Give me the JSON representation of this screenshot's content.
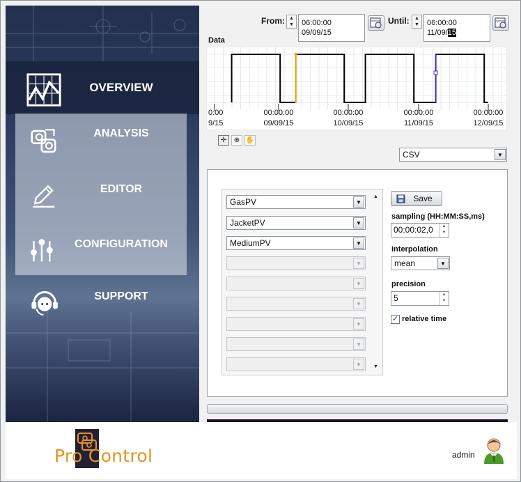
{
  "sidebar": {
    "items": [
      {
        "label": "OVERVIEW",
        "icon": "chart-icon",
        "active": true
      },
      {
        "label": "ANALYSIS",
        "icon": "analysis-icon"
      },
      {
        "label": "EDITOR",
        "icon": "pencil-icon"
      },
      {
        "label": "CONFIGURATION",
        "icon": "sliders-icon"
      },
      {
        "label": "SUPPORT",
        "icon": "headset-icon"
      }
    ]
  },
  "time_range": {
    "from_label": "From:",
    "from_time": "06:00:00",
    "from_date": "09/09/15",
    "until_label": "Until:",
    "until_time": "06:00:00",
    "until_date_prefix": "11/09/",
    "until_date_selected": "15"
  },
  "data_chart": {
    "title": "Data",
    "x_ticks": [
      {
        "time": "0:00",
        "date": "9/15"
      },
      {
        "time": "00:00:00",
        "date": "09/09/15"
      },
      {
        "time": "00:00:00",
        "date": "10/09/15"
      },
      {
        "time": "00:00:00",
        "date": "11/09/15"
      },
      {
        "time": "00:00:00",
        "date": "12/09/15"
      }
    ],
    "colors": {
      "signal": "#000000",
      "from_marker": "#f0a400",
      "until_marker": "#5533b8"
    }
  },
  "chart_data": {
    "type": "line",
    "title": "Data",
    "x_tick_labels": [
      "0:00 9/15",
      "00:00:00 09/09/15",
      "00:00:00 10/09/15",
      "00:00:00 11/09/15",
      "00:00:00 12/09/15"
    ],
    "series": [
      {
        "values_description": "step",
        "x": [
          "08/09/15 06:00",
          "08/09/15 06:00",
          "08/09/15 23:00",
          "08/09/15 23:00",
          "09/09/15 06:00",
          "09/09/15 06:00",
          "09/09/15 23:00",
          "09/09/15 23:00",
          "10/09/15 06:00",
          "10/09/15 06:00",
          "10/09/15 23:00",
          "10/09/15 23:00",
          "11/09/15 06:00",
          "11/09/15 06:00",
          "11/09/15 23:00",
          "11/09/15 23:00",
          "12/09/15 00:00"
        ],
        "y": [
          0,
          1,
          1,
          0,
          0,
          1,
          1,
          0,
          0,
          1,
          1,
          0,
          0,
          1,
          1,
          0,
          0
        ]
      }
    ],
    "markers": [
      {
        "label": "From",
        "x": "09/09/15 06:00",
        "color": "#f0a400"
      },
      {
        "label": "Until",
        "x": "11/09/15 06:00",
        "color": "#5533b8"
      }
    ],
    "ylim": [
      0,
      1
    ],
    "grid": true
  },
  "export": {
    "format": "CSV",
    "series_slots": [
      "GasPV",
      "JacketPV",
      "MediumPV",
      "",
      "",
      "",
      "",
      "",
      "",
      ""
    ],
    "save_label": "Save",
    "sampling_label": "sampling (HH:MM:SS,ms)",
    "sampling_value": "00:00:02,0",
    "interpolation_label": "interpolation",
    "interpolation_value": "mean",
    "precision_label": "precision",
    "precision_value": "5",
    "relative_time_label": "relative time",
    "relative_time_checked": true
  },
  "footer": {
    "brand": "Pro Control",
    "user": "admin"
  }
}
